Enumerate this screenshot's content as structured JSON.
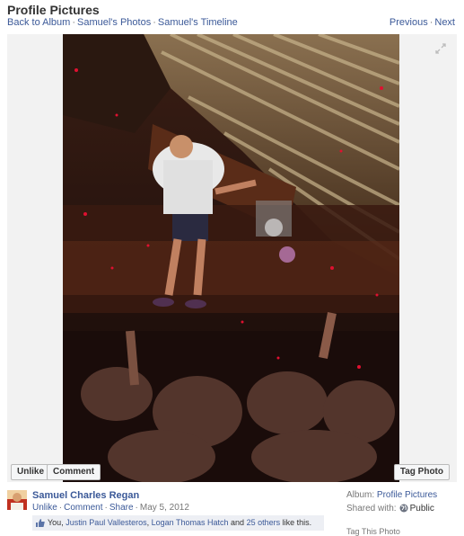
{
  "header": {
    "title": "Profile Pictures",
    "breadcrumbs": [
      "Back to Album",
      "Samuel's Photos",
      "Samuel's Timeline"
    ],
    "nav": {
      "previous": "Previous",
      "next": "Next"
    }
  },
  "photo_actions": {
    "unlike": "Unlike",
    "comment": "Comment",
    "tag": "Tag Photo"
  },
  "post": {
    "author": "Samuel Charles Regan",
    "unlike": "Unlike",
    "comment": "Comment",
    "share": "Share",
    "date": "May 5, 2012",
    "likes": {
      "you": "You,",
      "person1": "Justin Paul Vallesteros",
      "sep": ",",
      "person2": "Logan Thomas Hatch",
      "and": "and",
      "others": "25 others",
      "tail": "like this."
    }
  },
  "sidebar": {
    "album_label": "Album:",
    "album": "Profile Pictures",
    "shared_label": "Shared with:",
    "shared_value": "Public",
    "cut_text": "Tag This Photo"
  },
  "colors": {
    "link": "#3b5998",
    "muted": "#777777",
    "likes_bg": "#edeff4"
  }
}
